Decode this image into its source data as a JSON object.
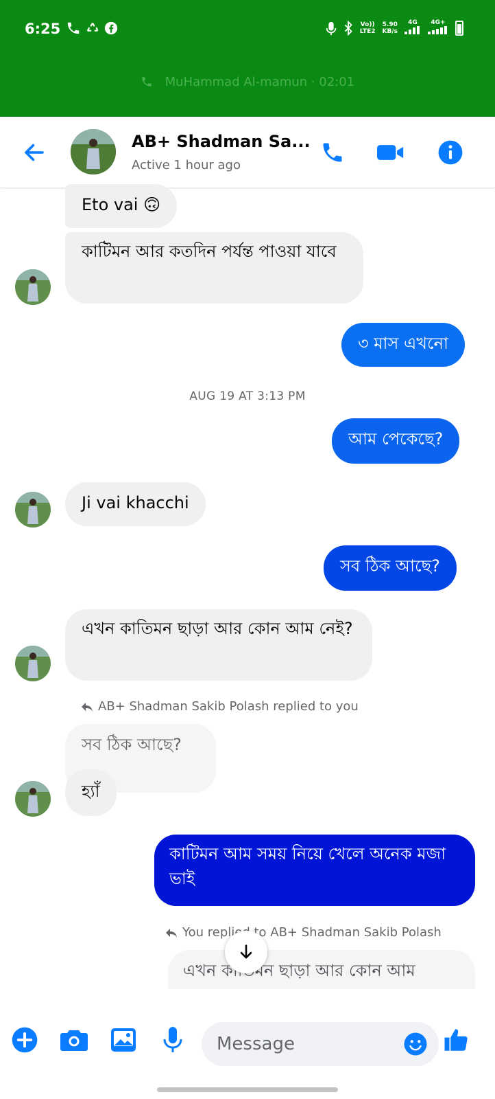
{
  "status_bar": {
    "time": "6:25",
    "volte": "Vo))",
    "lte": "LTE2",
    "speed": "5.90",
    "speed_unit": "KB/s",
    "net1": "4G",
    "net2": "4G+"
  },
  "call_banner": {
    "text": "MuHammad Al-mamun · 02:01"
  },
  "header": {
    "contact_name": "AB+ Shadman Sa...",
    "status": "Active 1 hour ago"
  },
  "messages": [
    {
      "id": "m1",
      "dir": "in",
      "text": "Eto vai 🙃"
    },
    {
      "id": "m2",
      "dir": "in",
      "text": "কাটিমন আর কতদিন পর্যন্ত পাওয়া যাবে"
    },
    {
      "id": "m3",
      "dir": "out",
      "text": "৩ মাস এখনো"
    },
    {
      "id": "m4",
      "dir": "out",
      "text": "আম পেকেছে?"
    },
    {
      "id": "m5",
      "dir": "in",
      "text": "Ji vai khacchi"
    },
    {
      "id": "m6",
      "dir": "out",
      "text": "সব ঠিক আছে?"
    },
    {
      "id": "m7",
      "dir": "in",
      "text": "এখন কাতিমন ছাড়া আর কোন আম নেই?"
    },
    {
      "id": "m8",
      "dir": "in",
      "text": "সব ঠিক আছে?"
    },
    {
      "id": "m9",
      "dir": "in",
      "text": "হ্যাঁ"
    },
    {
      "id": "m10",
      "dir": "out",
      "text": "কাটিমন আম সময় নিয়ে খেলে অনেক মজা ভাই"
    },
    {
      "id": "m11",
      "dir": "out",
      "text": "এখন কাতিমন ছাড়া আর কোন আম"
    }
  ],
  "timestamp": "AUG 19 AT 3:13 PM",
  "reply_notes": {
    "incoming": "AB+ Shadman Sakib Polash replied to you",
    "outgoing": "You replied to AB+ Shadman Sakib Polash"
  },
  "composer": {
    "placeholder": "Message"
  },
  "colors": {
    "status_green": "#0a8a12",
    "messenger_blue": "#0a7cff",
    "gradient_dark": "#0015d6",
    "incoming_bubble": "#f0f0f0"
  }
}
